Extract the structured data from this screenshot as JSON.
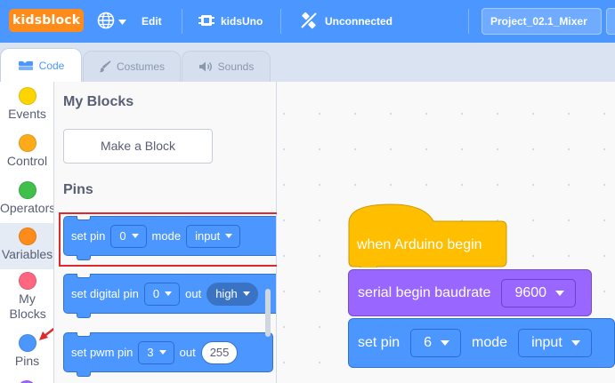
{
  "menubar": {
    "logo": "kidsblock",
    "edit": "Edit",
    "device": "kidsUno",
    "connection": "Unconnected",
    "project_title": "Project_02.1_Mixer"
  },
  "tabs": [
    {
      "label": "Code",
      "icon": "code-icon",
      "active": true
    },
    {
      "label": "Costumes",
      "icon": "brush-icon",
      "active": false
    },
    {
      "label": "Sounds",
      "icon": "speaker-icon",
      "active": false
    }
  ],
  "categories": [
    {
      "label": "Events",
      "color": "#ffd500"
    },
    {
      "label": "Control",
      "color": "#ffab19"
    },
    {
      "label": "Operators",
      "color": "#40bf4a"
    },
    {
      "label": "Variables",
      "color": "#ff8c1a"
    },
    {
      "label": "My Blocks",
      "color": "#ff6680"
    },
    {
      "label": "Pins",
      "color": "#4c97ff"
    }
  ],
  "flyout": {
    "my_blocks_heading": "My Blocks",
    "make_block_button": "Make a Block",
    "pins_heading": "Pins",
    "set_pin": {
      "label": "set pin",
      "pin": "0",
      "mode_label": "mode",
      "mode": "input"
    },
    "set_digital_pin": {
      "label": "set digital pin",
      "pin": "0",
      "out_label": "out",
      "value": "high"
    },
    "set_pwm_pin": {
      "label": "set pwm pin",
      "pin": "3",
      "out_label": "out",
      "value": "255"
    }
  },
  "workspace": {
    "hat_block": "when Arduino begin",
    "serial_block": {
      "label": "serial begin baudrate",
      "baud": "9600"
    },
    "set_pin_block": {
      "label": "set pin",
      "pin": "6",
      "mode_label": "mode",
      "mode": "input"
    }
  },
  "colors": {
    "menubar": "#4c97ff",
    "logo": "#ff8c1a",
    "events": "#ffbf00",
    "pins": "#4c97ff",
    "serial": "#9966ff",
    "highlight": "#e0292c"
  }
}
